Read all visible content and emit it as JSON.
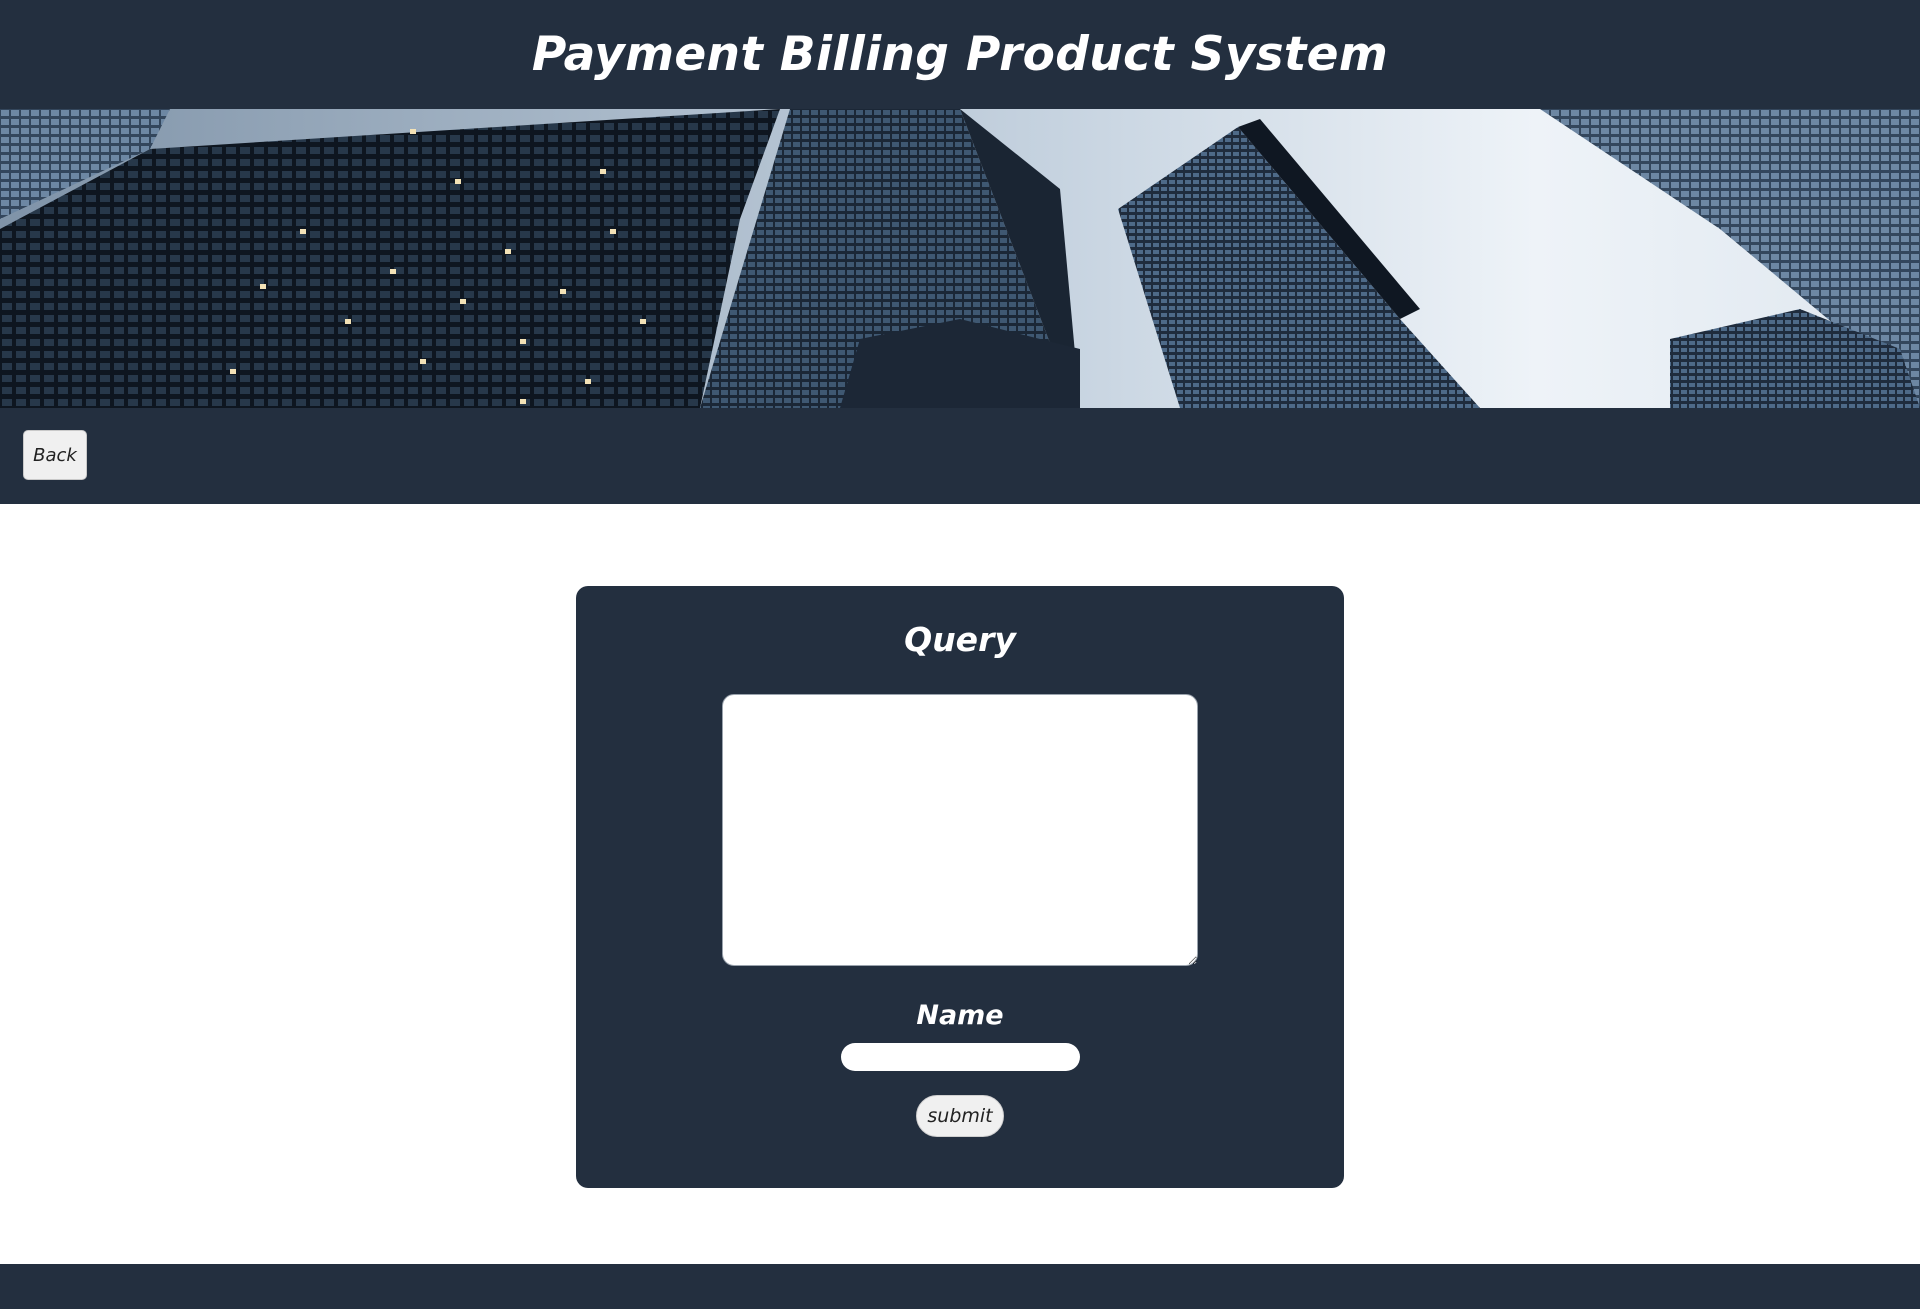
{
  "header": {
    "title": "Payment Billing Product System"
  },
  "nav": {
    "back_label": "Back"
  },
  "form": {
    "title": "Query",
    "query_value": "",
    "name_label": "Name",
    "name_value": "",
    "submit_label": "submit"
  },
  "colors": {
    "dark_navy": "#232f3f",
    "button_gray": "#f0f0f0",
    "page_background": "#ffffff"
  }
}
